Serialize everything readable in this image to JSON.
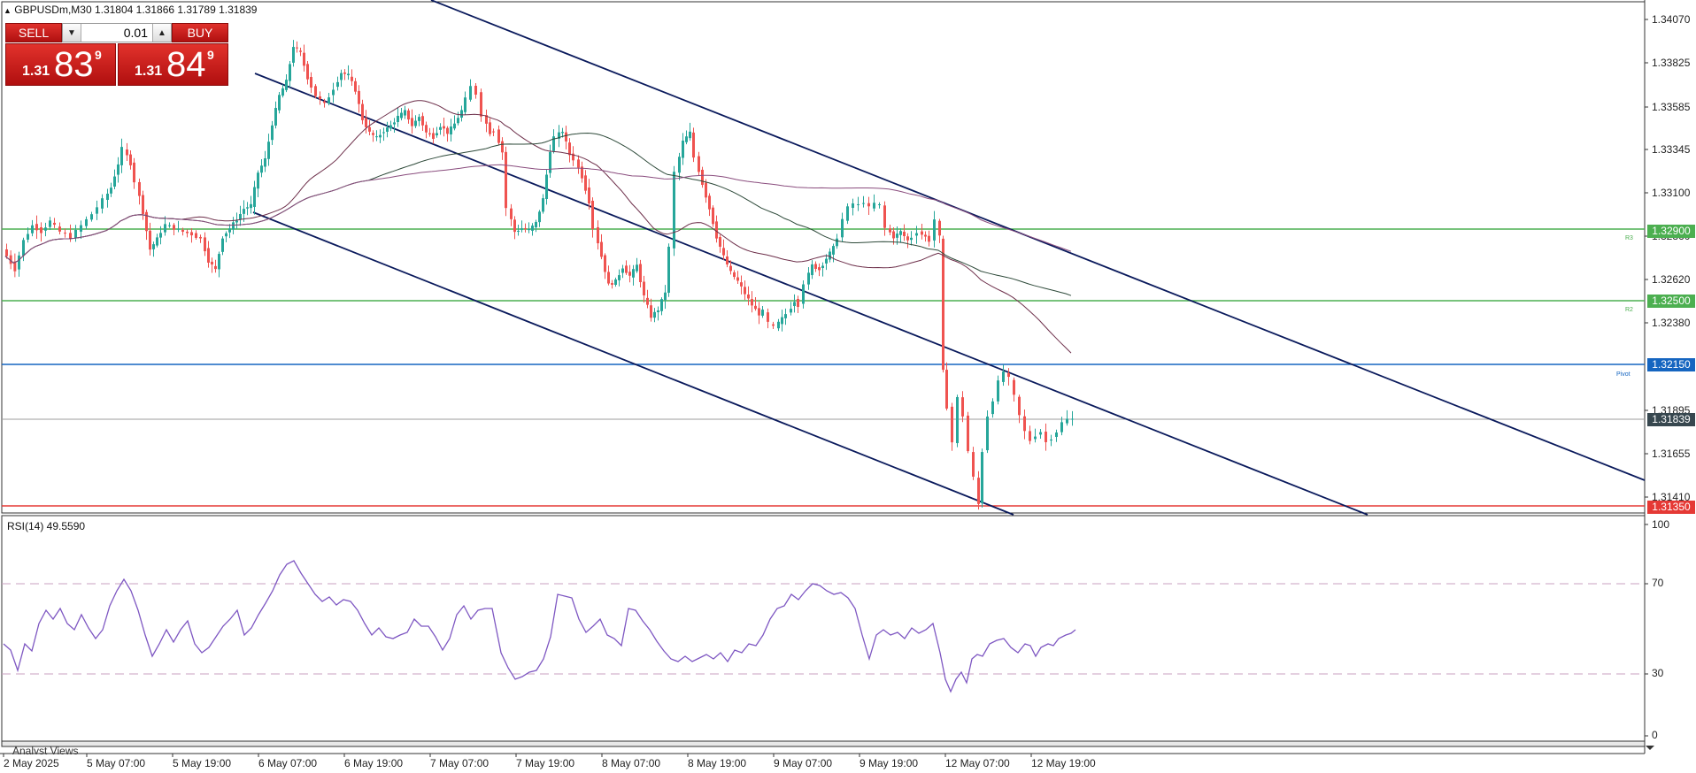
{
  "window": {
    "symbol_title": "GBPUSDm,M30  1.31804 1.31866 1.31789 1.31839",
    "rsi_title": "RSI(14) 49.5590",
    "bottom_tab": "Analyst Views"
  },
  "trade_panel": {
    "sell_label": "SELL",
    "buy_label": "BUY",
    "lot_value": "0.01",
    "sell_price": {
      "prefix": "1.31",
      "big": "83",
      "sup": "9"
    },
    "buy_price": {
      "prefix": "1.31",
      "big": "84",
      "sup": "9"
    }
  },
  "price_axis": {
    "labels": [
      "1.34070",
      "1.33825",
      "1.33585",
      "1.33345",
      "1.33100",
      "1.32860",
      "1.32620",
      "1.32380",
      "1.31895",
      "1.31655",
      "1.31410"
    ]
  },
  "price_levels": [
    {
      "value": "1.32900",
      "label": "R3",
      "color": "#4caf50"
    },
    {
      "value": "1.32500",
      "label": "R2",
      "color": "#4caf50"
    },
    {
      "value": "1.32150",
      "label": "Pivot",
      "color": "#1565c0"
    },
    {
      "value": "1.31839",
      "label": "",
      "color": "#37474f"
    },
    {
      "value": "1.31350",
      "label": "",
      "color": "#e53935"
    }
  ],
  "rsi_axis": {
    "labels": [
      "100",
      "70",
      "30",
      "0"
    ]
  },
  "time_axis": {
    "labels": [
      "2 May 2025",
      "5 May 07:00",
      "5 May 19:00",
      "6 May 07:00",
      "6 May 19:00",
      "7 May 07:00",
      "7 May 19:00",
      "8 May 07:00",
      "8 May 19:00",
      "9 May 07:00",
      "9 May 19:00",
      "12 May 07:00",
      "12 May 19:00"
    ]
  },
  "colors": {
    "bull": "#26a69a",
    "bear": "#ef5350",
    "channel": "#0a1a5c",
    "ma1": "#6d2f4a",
    "ma2": "#2e4a3a",
    "ma3": "#8a4d7e",
    "rsi": "#7e57c2"
  }
}
